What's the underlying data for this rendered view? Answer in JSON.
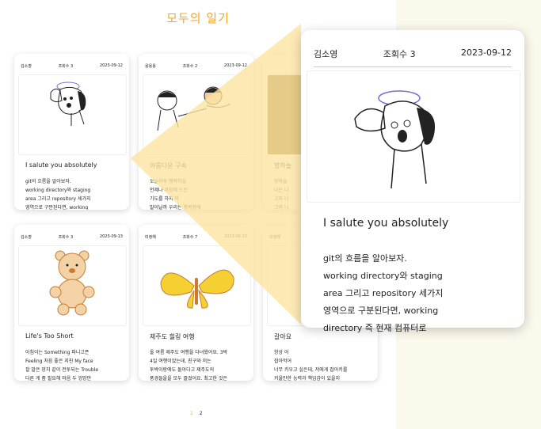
{
  "page": {
    "title": "모두의 일기"
  },
  "cards": [
    {
      "author": "김소영",
      "views": "조회수 3",
      "date": "2023-09-12",
      "image": "dog-saluting",
      "title": "I salute you absolutely",
      "body": "git의 흐름을 알아보자.\nworking directory와 staging\narea 그리고 repository 세가지\n영역으로 구분된다면, working\ndirectory 즉 현재 컴퓨터로"
    },
    {
      "author": "용용용",
      "views": "조회수 2",
      "date": "2023-09-12",
      "image": "two-friends",
      "title": "아름다운 구속",
      "body": "오늘하루 행복하길\n언제나 마음에 드든\n기도를 하지 마\n말이날까 우리는 행복함에\n딸 만난 건 행운이야"
    },
    {
      "author": "",
      "views": "",
      "date": "",
      "image": "brown-photo",
      "title": "망하늘",
      "body": "망하늘\n너는 니\n고지 니\n그저 니\n잘 않아"
    },
    {
      "author": "김소영",
      "views": "조회수 3",
      "date": "2023-09-13",
      "image": "teddy-bear",
      "title": "Life's Too Short",
      "body": "아침이는 Something 파니고픈\nFeeling 처음 좋은 지친 My face\n잘 말은 망치 같이 전투되는 Trouble\n다른 게 좀 필요해 마음 두 엉망만\nCause life's too short 장없이다"
    },
    {
      "author": "미정해",
      "views": "조회수 7",
      "date": "2023-09-13",
      "image": "butterfly",
      "title": "제주도 힐링 여행",
      "body": "올 여름 제주도 여행을 다녀왔어요. 3박\n4일 여행이었는데, 친구와 저는\n투박이랑에도 돌아다고 제주도의\n풍경들을을 모두 즐겼어요. 최고한 것은\n아니었지만 이상하게 좋은다 그렇게"
    },
    {
      "author": "미정해",
      "views": "",
      "date": "",
      "image": "",
      "title": "갈아요",
      "body": "항상 어\n잡아먹어\n너무 키우고 싶은데, 저에게 잡아키를\n키울만한 능력과 책임감이 있을지\n자존이에요. 과연 매일 잡아키를"
    }
  ],
  "pagination": {
    "current": "1",
    "next": "2"
  },
  "detail": {
    "author": "김소영",
    "views": "조회수 3",
    "date": "2023-09-12",
    "image": "dog-saluting",
    "title": "I salute you absolutely",
    "body": "git의 흐름을 알아보자.\nworking directory와 staging\narea 그리고 repository 세가지\n영역으로 구분된다면, working\ndirectory 즉 현재 컴퓨터로"
  },
  "colors": {
    "accent": "#f5a623",
    "beam": "#fde3a0"
  }
}
